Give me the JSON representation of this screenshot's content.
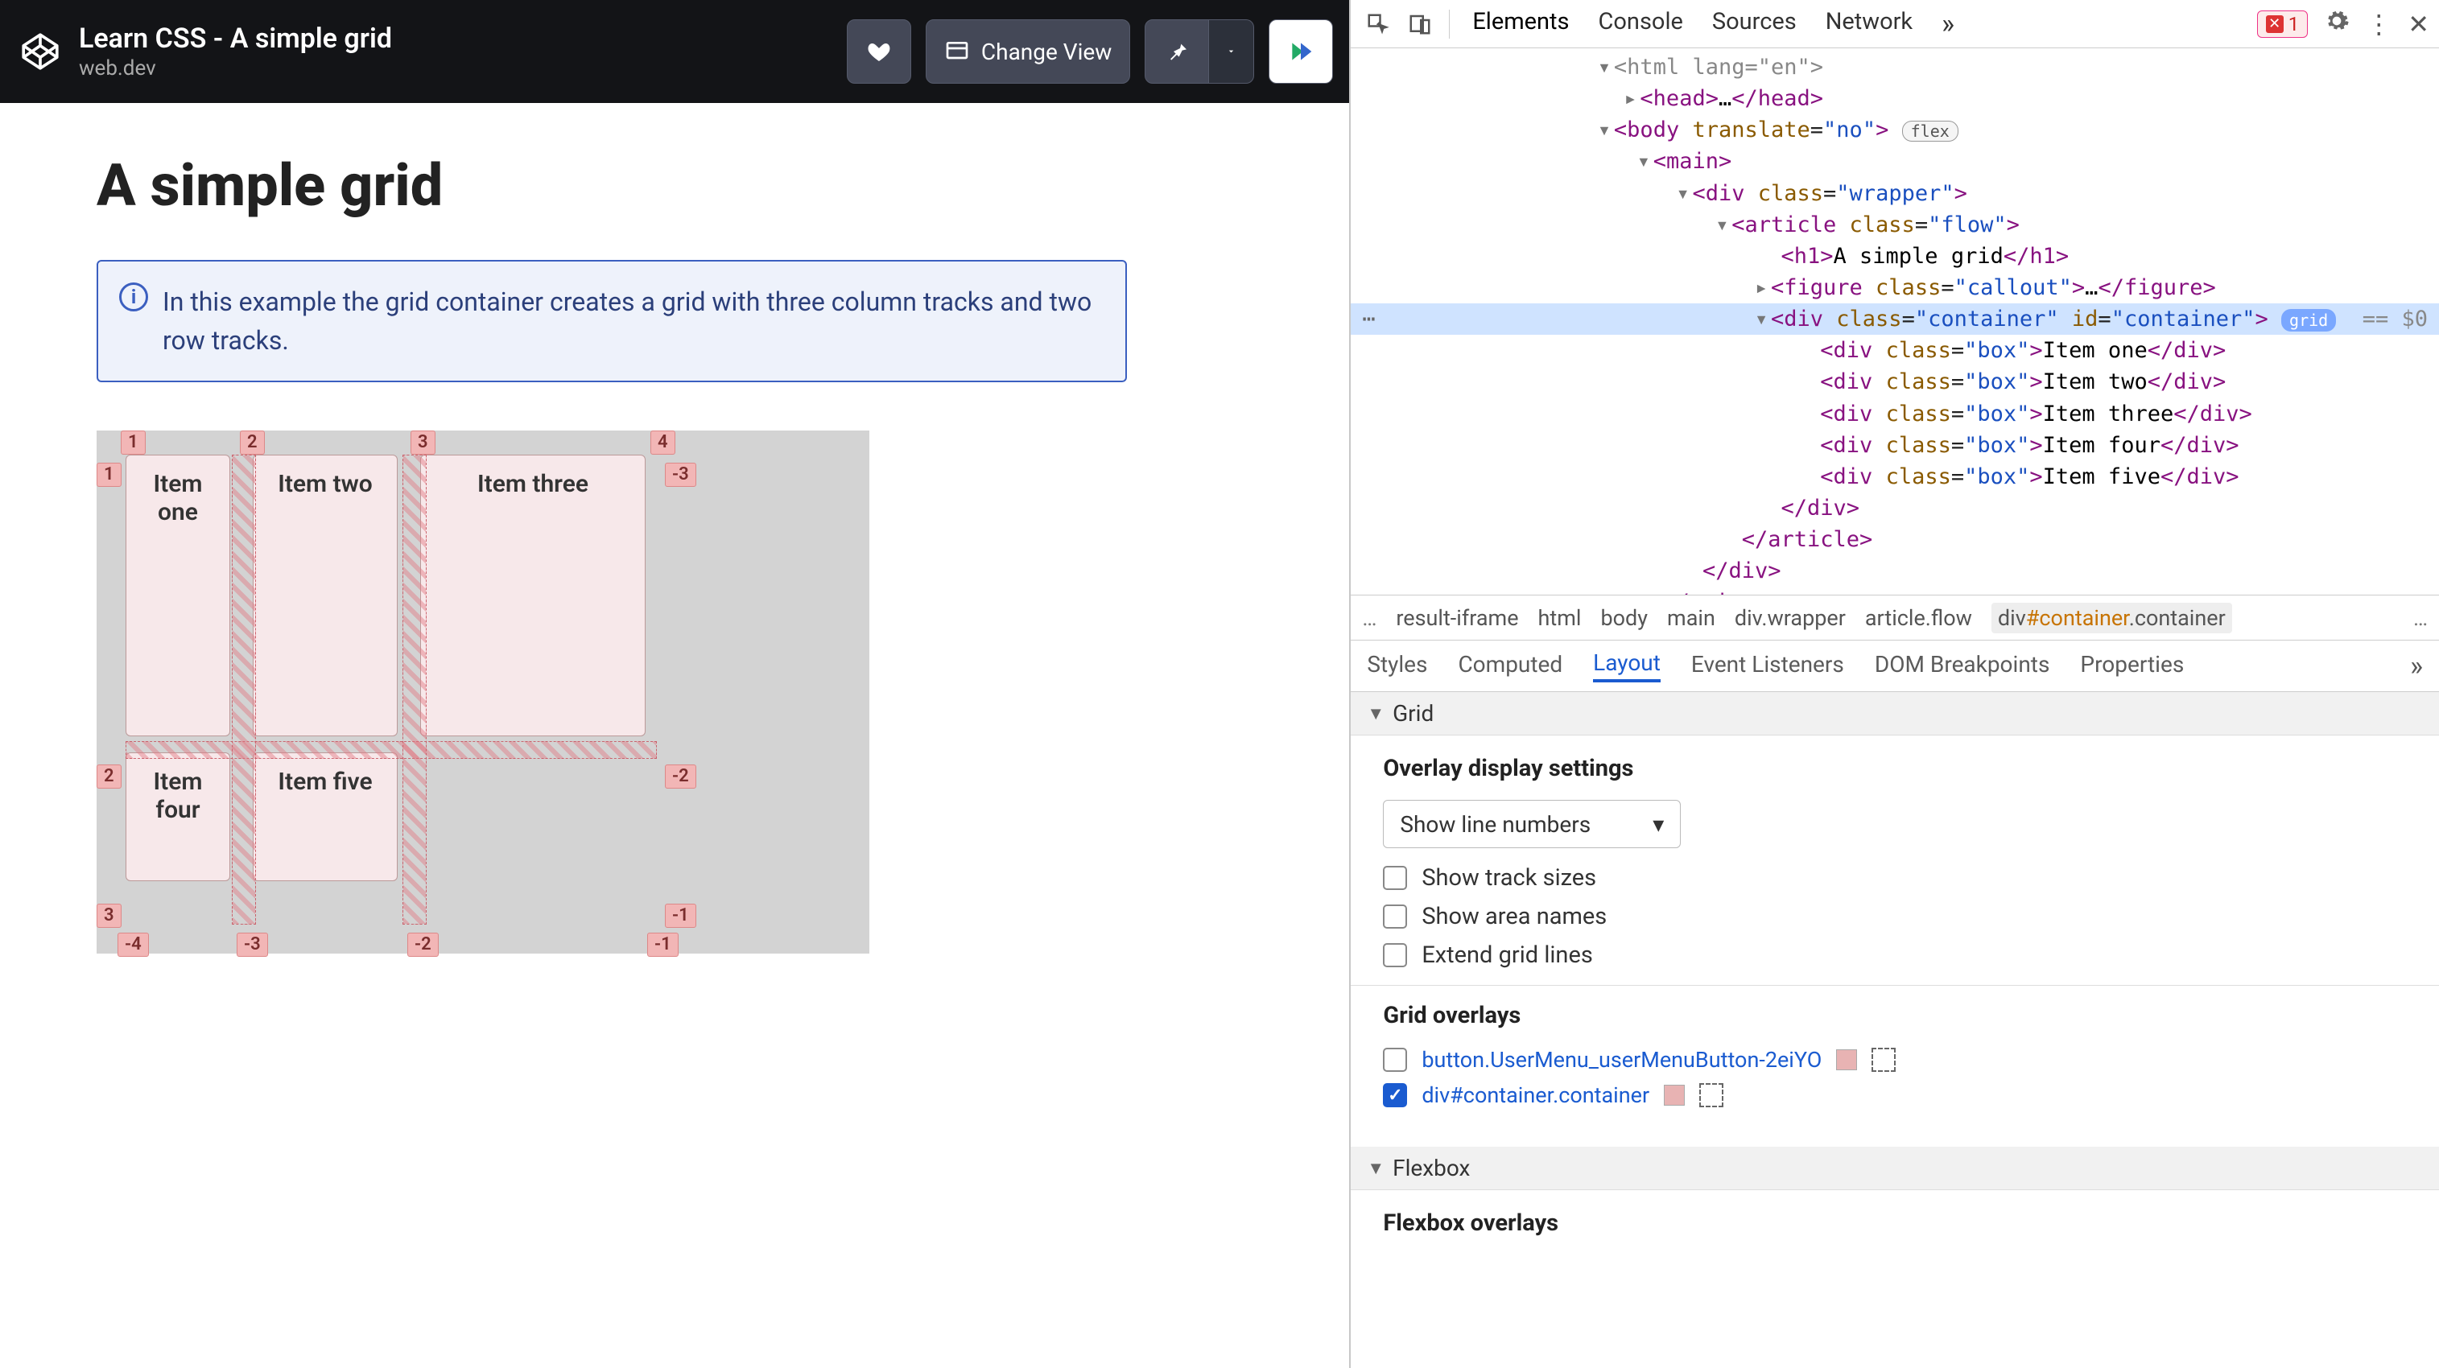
{
  "topbar": {
    "title": "Learn CSS - A simple grid",
    "subtitle": "web.dev",
    "change_view_label": "Change View"
  },
  "preview": {
    "heading": "A simple grid",
    "callout_text": "In this example the grid container creates a grid with three column tracks and two row tracks.",
    "grid_items": [
      "Item one",
      "Item two",
      "Item three",
      "Item four",
      "Item five"
    ],
    "line_labels": {
      "top": [
        "1",
        "2",
        "3",
        "4"
      ],
      "left": [
        "1",
        "2",
        "3"
      ],
      "right": [
        "-3",
        "-2",
        "-1"
      ],
      "bottom": [
        "-4",
        "-3",
        "-2",
        "-1"
      ]
    }
  },
  "devtools": {
    "main_tabs": [
      "Elements",
      "Console",
      "Sources",
      "Network"
    ],
    "active_main_tab": "Elements",
    "error_count": "1",
    "dom": {
      "html_lang_fragment": "<html lang=\"en\">",
      "head": "<head>…</head>",
      "body_open": {
        "tag": "body",
        "attr": "translate",
        "val": "no",
        "badge": "flex"
      },
      "main_open": "<main>",
      "wrapper_open": {
        "tag": "div",
        "attr": "class",
        "val": "wrapper"
      },
      "article_open": {
        "tag": "article",
        "attr": "class",
        "val": "flow"
      },
      "h1_text": "A simple grid",
      "figure": {
        "tag": "figure",
        "attr": "class",
        "val": "callout"
      },
      "container_open": {
        "tag": "div",
        "class": "container",
        "id": "container",
        "badge": "grid",
        "eq": "== $0"
      },
      "boxes": [
        {
          "class": "box",
          "text": "Item one"
        },
        {
          "class": "box",
          "text": "Item two"
        },
        {
          "class": "box",
          "text": "Item three"
        },
        {
          "class": "box",
          "text": "Item four"
        },
        {
          "class": "box",
          "text": "Item five"
        }
      ]
    },
    "breadcrumb": [
      "…",
      "result-iframe",
      "html",
      "body",
      "main",
      "div.wrapper",
      "article.flow",
      "div#container.container"
    ],
    "sub_tabs": [
      "Styles",
      "Computed",
      "Layout",
      "Event Listeners",
      "DOM Breakpoints",
      "Properties"
    ],
    "active_sub_tab": "Layout",
    "layout": {
      "grid_section_title": "Grid",
      "overlay_settings_title": "Overlay display settings",
      "select_value": "Show line numbers",
      "checkboxes": [
        {
          "label": "Show track sizes",
          "checked": false
        },
        {
          "label": "Show area names",
          "checked": false
        },
        {
          "label": "Extend grid lines",
          "checked": false
        }
      ],
      "grid_overlays_title": "Grid overlays",
      "grid_overlays": [
        {
          "label": "button.UserMenu_userMenuButton-2eiYO",
          "checked": false
        },
        {
          "label": "div#container.container",
          "checked": true
        }
      ],
      "flexbox_section_title": "Flexbox",
      "flexbox_overlays_title": "Flexbox overlays"
    }
  }
}
